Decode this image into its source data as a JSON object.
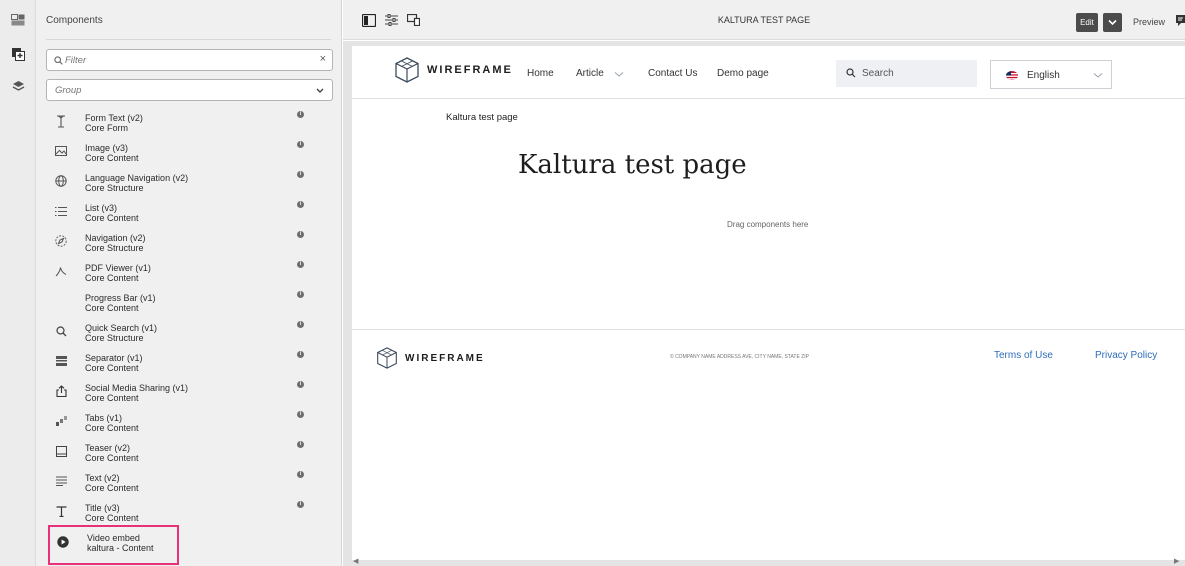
{
  "panel": {
    "title": "Components",
    "filter_placeholder": "Filter",
    "group_placeholder": "Group"
  },
  "components": [
    {
      "title": "Form Text (v2)",
      "group": "Core Form",
      "icon": "text-cursor-icon"
    },
    {
      "title": "Image (v3)",
      "group": "Core Content",
      "icon": "image-icon"
    },
    {
      "title": "Language Navigation (v2)",
      "group": "Core Structure",
      "icon": "globe-icon"
    },
    {
      "title": "List (v3)",
      "group": "Core Content",
      "icon": "list-icon"
    },
    {
      "title": "Navigation (v2)",
      "group": "Core Structure",
      "icon": "compass-icon"
    },
    {
      "title": "PDF Viewer (v1)",
      "group": "Core Content",
      "icon": "pdf-icon"
    },
    {
      "title": "Progress Bar (v1)",
      "group": "Core Content",
      "icon": ""
    },
    {
      "title": "Quick Search (v1)",
      "group": "Core Structure",
      "icon": "search-icon"
    },
    {
      "title": "Separator (v1)",
      "group": "Core Content",
      "icon": "separator-icon"
    },
    {
      "title": "Social Media Sharing (v1)",
      "group": "Core Content",
      "icon": "share-icon"
    },
    {
      "title": "Tabs (v1)",
      "group": "Core Content",
      "icon": "tabs-icon"
    },
    {
      "title": "Teaser (v2)",
      "group": "Core Content",
      "icon": "teaser-icon"
    },
    {
      "title": "Text (v2)",
      "group": "Core Content",
      "icon": "text-icon"
    },
    {
      "title": "Title (v3)",
      "group": "Core Content",
      "icon": "title-icon"
    },
    {
      "title": "Video embed",
      "group": "kaltura - Content",
      "icon": "play-circle-icon",
      "selected": true
    }
  ],
  "topbar": {
    "page_title": "KALTURA TEST PAGE",
    "edit_label": "Edit",
    "preview_label": "Preview"
  },
  "site": {
    "logo_text": "WIREFRAME",
    "nav": [
      "Home",
      "Article",
      "Contact Us",
      "Demo page"
    ],
    "search_placeholder": "Search",
    "language": "English",
    "breadcrumb": "Kaltura test page",
    "heading": "Kaltura test page",
    "drop_hint": "Drag components here",
    "footer_logo_text": "WIREFRAME",
    "copyright": "© COMPANY NAME ADDRESS AVE, CITY NAME, STATE ZIP",
    "footer_links": [
      "Terms of Use",
      "Privacy Policy"
    ]
  },
  "colors": {
    "selection_border": "#e8317b",
    "link": "#2d6dbb",
    "dark_button": "#4b4b4b"
  }
}
